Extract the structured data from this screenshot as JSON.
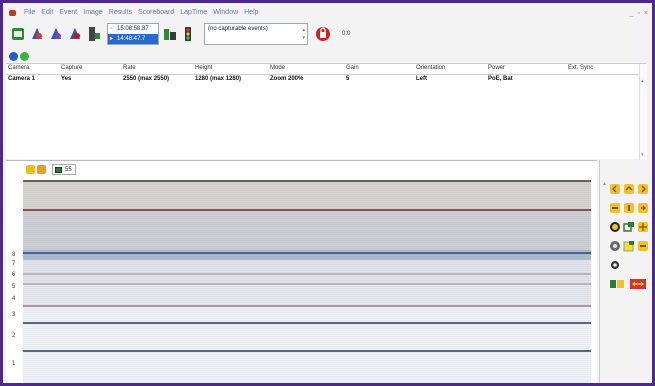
{
  "menu": [
    "File",
    "Edit",
    "Event",
    "Image",
    "Results",
    "Scoreboard",
    "LapTime",
    "Window",
    "Help"
  ],
  "window_controls": [
    "_",
    "▫",
    "×"
  ],
  "toolbar": {
    "time_top": "15:08:58.87",
    "time_bottom": "14:48:47.7",
    "events_placeholder": "(no capturable events)",
    "ratio": "0:0"
  },
  "colors": {
    "frame_border": "#4b2a8a",
    "status_blue": "#1e5fcf",
    "status_green": "#36b53a",
    "selection_blue": "#2a6ad0"
  },
  "table": {
    "headers": [
      "Camera",
      "Capture",
      "Rate",
      "Height",
      "Mode",
      "Gain",
      "Orientation",
      "Power",
      "Ext. Sync"
    ],
    "rows": [
      [
        "Camera 1",
        "Yes",
        "2550  (max 2550)",
        "1280  (max 1280)",
        "Zoom 200%",
        "5",
        "Left",
        "PoE, Bat",
        ""
      ]
    ]
  },
  "image_panel": {
    "frame_count": "55",
    "row_labels": [
      "8",
      "7",
      "6",
      "5",
      "4",
      "3",
      "2",
      "1"
    ]
  }
}
